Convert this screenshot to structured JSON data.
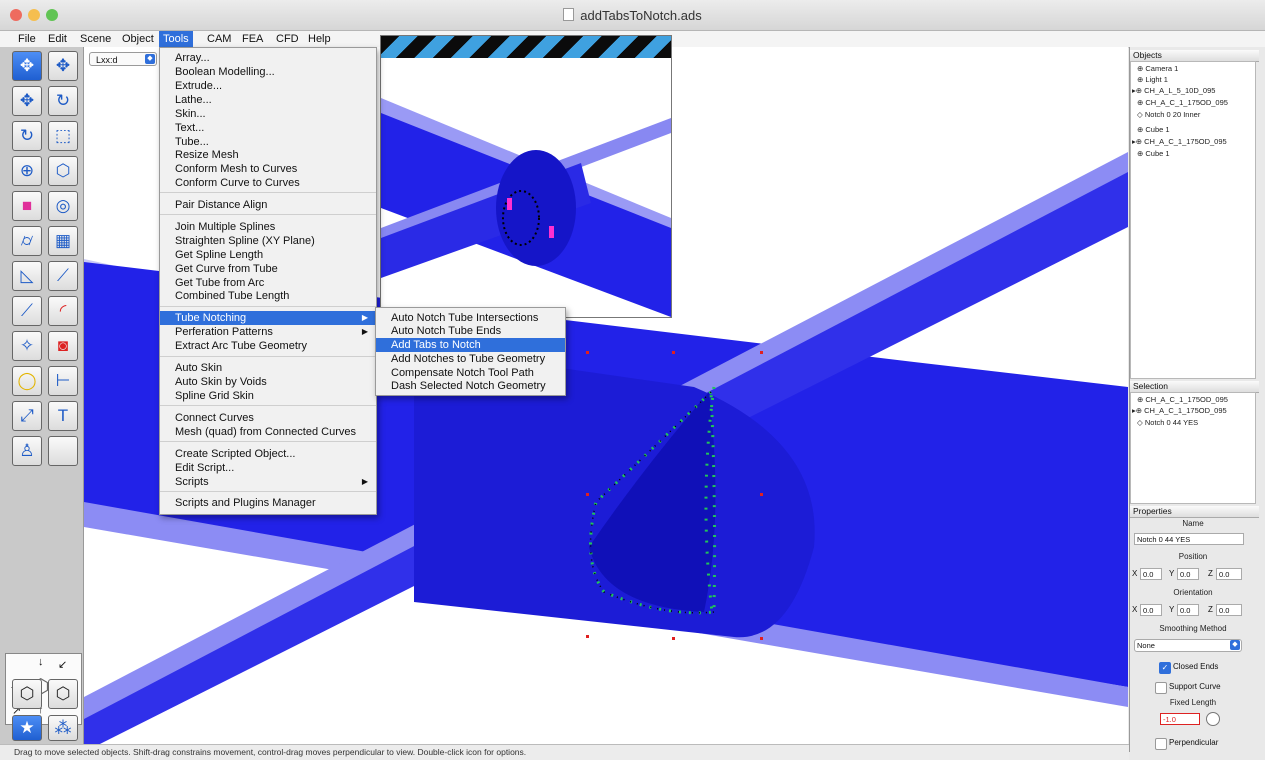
{
  "window": {
    "title": "addTabsToNotch.ads",
    "traffic_lights": [
      "#ee6b5f",
      "#f5be4f",
      "#61c454"
    ]
  },
  "menubar": {
    "items": [
      "File",
      "Edit",
      "Scene",
      "Object",
      "Tools",
      "CAM",
      "FEA",
      "CFD",
      "Help"
    ],
    "active": "Tools"
  },
  "viewport": {
    "view_select": "Lxx:d"
  },
  "tools_menu": {
    "items": [
      "Array...",
      "Boolean Modelling...",
      "Extrude...",
      "Lathe...",
      "Skin...",
      "Text...",
      "Tube...",
      "Resize Mesh",
      "Conform Mesh to Curves",
      "Conform Curve to Curves",
      "Pair Distance Align",
      "Join Multiple Splines",
      "Straighten Spline (XY Plane)",
      "Get Spline Length",
      "Get Curve from Tube",
      "Get Tube from Arc",
      "Combined Tube Length",
      "Tube Notching",
      "Perferation Patterns",
      "Extract Arc Tube Geometry",
      "Auto Skin",
      "Auto Skin by Voids",
      "Spline Grid Skin",
      "Connect Curves",
      "Mesh (quad) from Connected Curves",
      "Create Scripted Object...",
      "Edit Script...",
      "Scripts",
      "Scripts and Plugins Manager"
    ],
    "highlighted": "Tube Notching"
  },
  "tube_notching_submenu": {
    "items": [
      "Auto Notch Tube Intersections",
      "Auto Notch Tube Ends",
      "Add Tabs to Notch",
      "Add Notches to Tube Geometry",
      "Compensate Notch Tool Path",
      "Dash Selected Notch Geometry"
    ],
    "highlighted": "Add Tabs to Notch"
  },
  "objects_panel": {
    "title": "Objects",
    "items": [
      "Camera 1",
      "Light 1",
      "CH_A_L_5_10D_095",
      "CH_A_C_1_175OD_095",
      "Notch 0 20 Inner",
      "Cube 1",
      "CH_A_C_1_175OD_095",
      "Cube 1"
    ]
  },
  "selection_panel": {
    "title": "Selection",
    "items": [
      "CH_A_C_1_175OD_095",
      "CH_A_C_1_175OD_095",
      "Notch 0 44 YES"
    ]
  },
  "properties": {
    "title": "Properties",
    "name_label": "Name",
    "name_value": "Notch 0 44 YES",
    "position_label": "Position",
    "orientation_label": "Orientation",
    "axis_x": "X",
    "axis_y": "Y",
    "axis_z": "Z",
    "position": {
      "x": "0.0",
      "y": "0.0",
      "z": "0.0"
    },
    "orientation": {
      "x": "0.0",
      "y": "0.0",
      "z": "0.0"
    },
    "smoothing_label": "Smoothing Method",
    "smoothing_value": "None",
    "closed_ends_label": "Closed Ends",
    "closed_ends": true,
    "support_curve_label": "Support Curve",
    "support_curve": false,
    "fixed_length_label": "Fixed Length",
    "fixed_length_value": "-1.0",
    "perpendicular_label": "Perpendicular",
    "perpendicular": false
  },
  "status_bar": {
    "text": "Drag to move selected objects.  Shift-drag constrains movement, control-drag moves perpendicular to view.  Double-click icon for options."
  },
  "colors": {
    "tube_blue": "#1f1fe6",
    "tube_light": "#8c8cf4",
    "highlight": "#2f6fdb",
    "tab_points": "#21c45a"
  }
}
